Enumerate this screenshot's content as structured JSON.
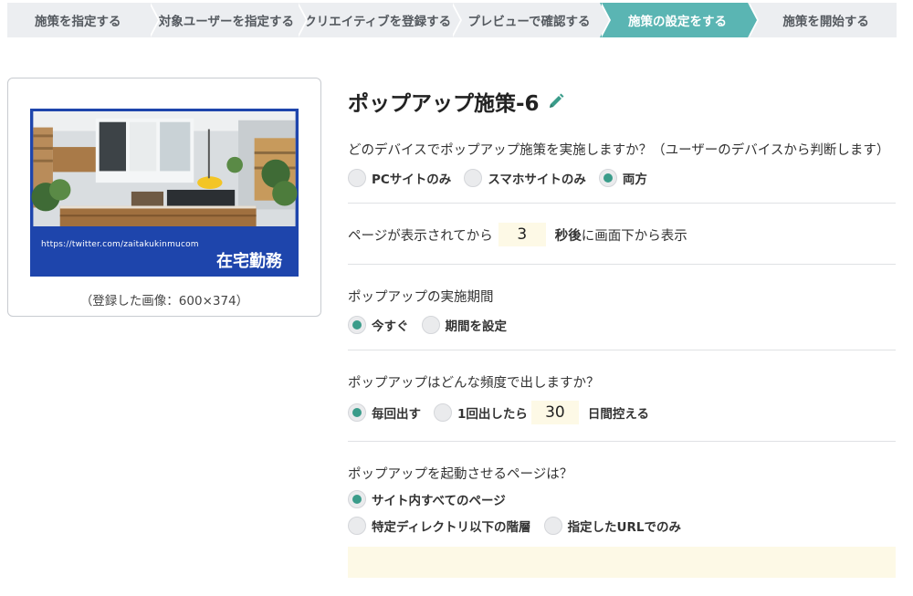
{
  "steps": [
    {
      "label": "施策を指定する",
      "active": false
    },
    {
      "label": "対象ユーザーを指定する",
      "active": false
    },
    {
      "label": "クリエイティブを登録する",
      "active": false
    },
    {
      "label": "プレビューで確認する",
      "active": false
    },
    {
      "label": "施策の設定をする",
      "active": true
    },
    {
      "label": "施策を開始する",
      "active": false
    }
  ],
  "preview": {
    "url_text": "https://twitter.com/zaitakukinmucom",
    "headline": "在宅勤務",
    "caption": "（登録した画像：600×374）"
  },
  "campaign": {
    "title": "ポップアップ施策-6",
    "edit_icon": "pencil-icon"
  },
  "device": {
    "question": "どのデバイスでポップアップ施策を実施しますか？（ユーザーのデバイスから判断します）",
    "options": [
      {
        "label": "PCサイトのみ",
        "checked": false
      },
      {
        "label": "スマホサイトのみ",
        "checked": false
      },
      {
        "label": "両方",
        "checked": true
      }
    ]
  },
  "delay": {
    "prefix": "ページが表示されてから",
    "value": "3",
    "unit": "秒後",
    "suffix": "に画面下から表示"
  },
  "period": {
    "question": "ポップアップの実施期間",
    "options": [
      {
        "label": "今すぐ",
        "checked": true
      },
      {
        "label": "期間を設定",
        "checked": false
      }
    ]
  },
  "frequency": {
    "question": "ポップアップはどんな頻度で出しますか？",
    "every_label": "毎回出す",
    "every_checked": true,
    "once_label": "1回出したら",
    "once_checked": false,
    "days_value": "30",
    "days_suffix": "日間控える"
  },
  "trigger": {
    "question": "ポップアップを起動させるページは？",
    "all_pages_label": "サイト内すべてのページ",
    "all_pages_checked": true,
    "dir_label": "特定ディレクトリ以下の階層",
    "dir_checked": false,
    "url_label": "指定したURLでのみ",
    "url_checked": false
  },
  "colors": {
    "accent": "#5ab5b3",
    "radio_checked": "#3a9c8a",
    "creative_blue": "#1e45ac",
    "input_bg": "#fdf9e6"
  }
}
